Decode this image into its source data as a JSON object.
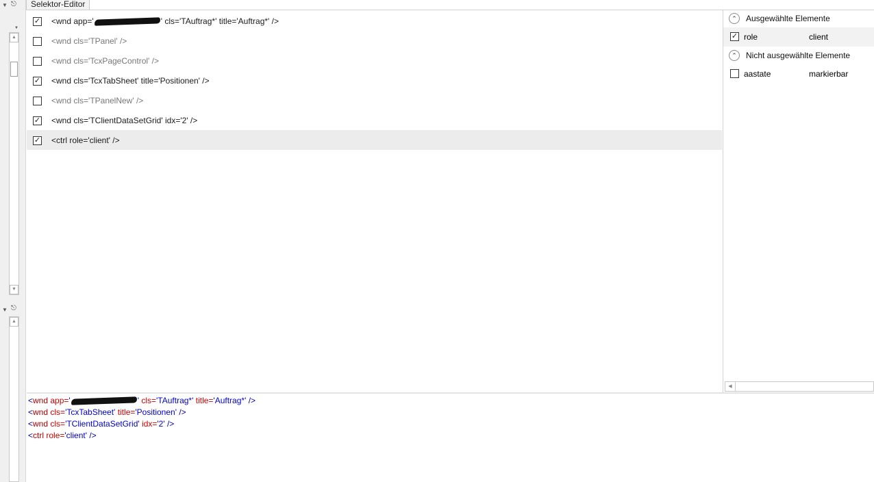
{
  "tab": {
    "label": "Selektor-Editor"
  },
  "selector_rows": [
    {
      "checked": true,
      "prefix": "<wnd app='",
      "redacted": true,
      "suffix": "' cls='TAuftrag*' title='Auftrag*' />"
    },
    {
      "checked": false,
      "prefix": "<wnd cls='TPanel' />"
    },
    {
      "checked": false,
      "prefix": "<wnd cls='TcxPageControl' />"
    },
    {
      "checked": true,
      "prefix": "<wnd cls='TcxTabSheet' title='Positionen' />"
    },
    {
      "checked": false,
      "prefix": "<wnd cls='TPanelNew' />"
    },
    {
      "checked": true,
      "prefix": "<wnd cls='TClientDataSetGrid' idx='2' />"
    },
    {
      "checked": true,
      "prefix": "<ctrl role='client' />",
      "selected": true
    }
  ],
  "right_panel": {
    "selected_group_label": "Ausgewählte Elemente",
    "selected_attrs": [
      {
        "name": "role",
        "value": "client",
        "checked": true
      }
    ],
    "unselected_group_label": "Nicht ausgewählte Elemente",
    "unselected_attrs": [
      {
        "name": "aastate",
        "value": "markierbar",
        "checked": false
      }
    ]
  },
  "code": {
    "lines": [
      [
        [
          "punct",
          "<"
        ],
        [
          "tag",
          "wnd "
        ],
        [
          "attr",
          "app="
        ],
        [
          "val",
          "'"
        ],
        [
          "redact",
          ""
        ],
        [
          "val",
          "'"
        ],
        [
          "attr",
          " cls="
        ],
        [
          "val",
          "'TAuftrag*'"
        ],
        [
          "attr",
          " title="
        ],
        [
          "val",
          "'Auftrag*'"
        ],
        [
          "punct",
          " />"
        ]
      ],
      [
        [
          "punct",
          "<"
        ],
        [
          "tag",
          "wnd "
        ],
        [
          "attr",
          "cls="
        ],
        [
          "val",
          "'TcxTabSheet'"
        ],
        [
          "attr",
          " title="
        ],
        [
          "val",
          "'Positionen'"
        ],
        [
          "punct",
          " />"
        ]
      ],
      [
        [
          "punct",
          "<"
        ],
        [
          "tag",
          "wnd "
        ],
        [
          "attr",
          "cls="
        ],
        [
          "val",
          "'TClientDataSetGrid'"
        ],
        [
          "attr",
          " idx="
        ],
        [
          "val",
          "'2'"
        ],
        [
          "punct",
          " />"
        ]
      ],
      [
        [
          "punct",
          "<"
        ],
        [
          "tag",
          "ctrl "
        ],
        [
          "attr",
          "role="
        ],
        [
          "val",
          "'client'"
        ],
        [
          "punct",
          " />"
        ]
      ]
    ]
  },
  "colors": {
    "tag": "#aa0000",
    "attr": "#cc0000",
    "value": "#0000cc",
    "punct": "#0000aa"
  },
  "icons": {
    "pin": "pin-icon",
    "collapse": "chevron-up-icon",
    "dropdown": "caret-down-icon",
    "check": "checkmark-icon"
  }
}
